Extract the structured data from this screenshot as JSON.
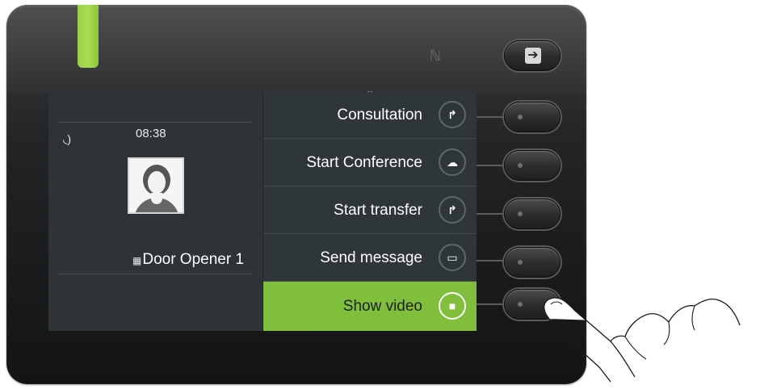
{
  "status": {
    "time": "08:38",
    "call_icon": "call-active-icon"
  },
  "contact": {
    "name": "Door Opener 1",
    "type_icon": "building-icon"
  },
  "menu": {
    "scroll_icon": "chevron-up-icon",
    "items": [
      {
        "label": "Consultation",
        "icon": "consultation-icon"
      },
      {
        "label": "Start Conference",
        "icon": "conference-icon"
      },
      {
        "label": "Start transfer",
        "icon": "transfer-icon"
      },
      {
        "label": "Send message",
        "icon": "message-icon"
      },
      {
        "label": "Show video",
        "icon": "video-camera-icon",
        "selected": true
      }
    ]
  },
  "hardware": {
    "leave_key_icon": "leave-icon",
    "nfc_icon": "nfc-icon",
    "led_color": "#9bd24a"
  },
  "colors": {
    "accent": "#7fbf3b",
    "screen_bg": "#2f3639"
  }
}
